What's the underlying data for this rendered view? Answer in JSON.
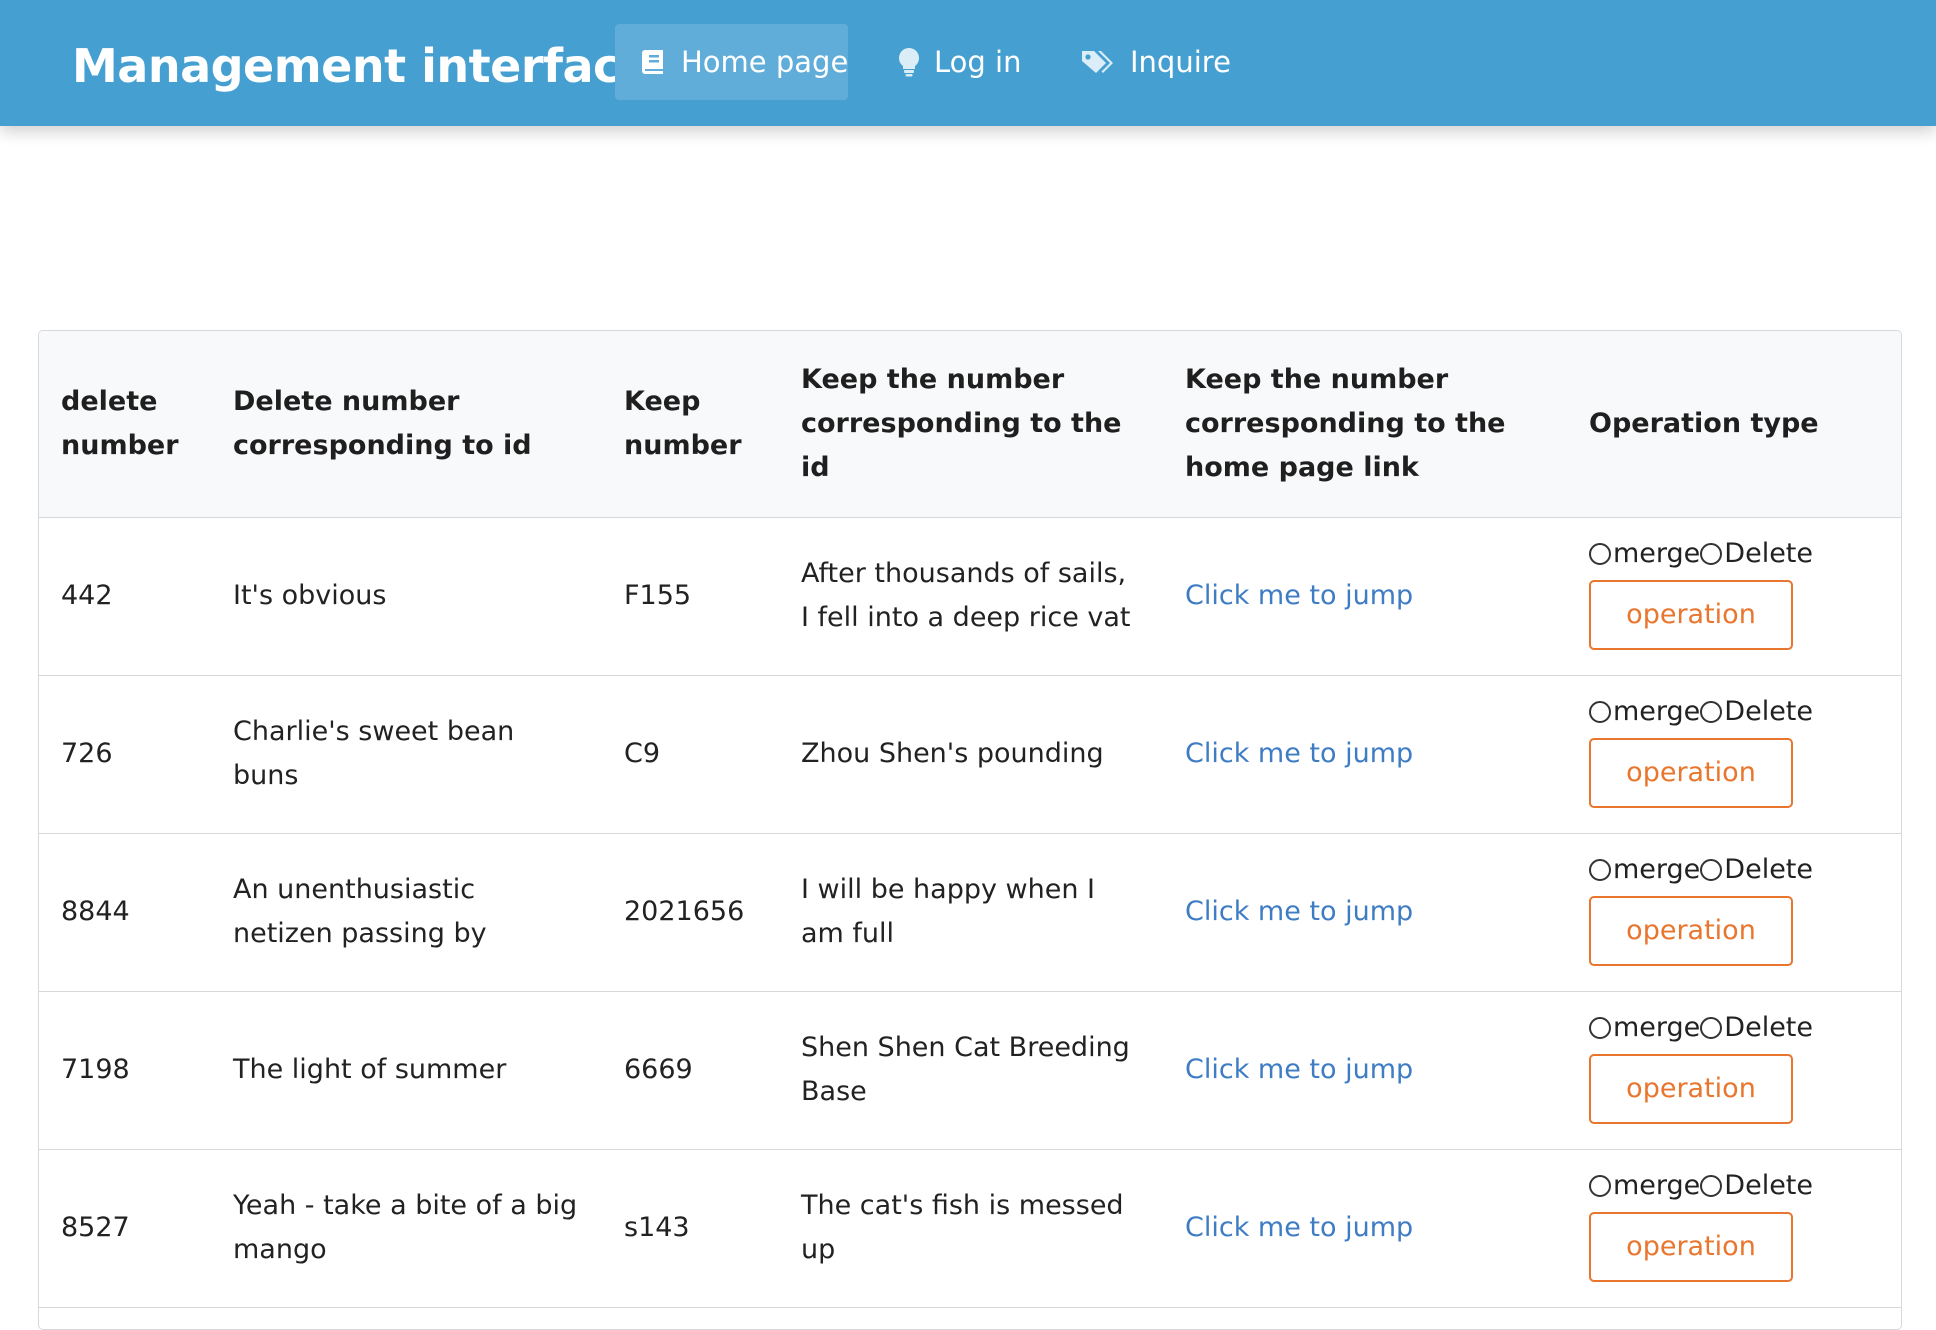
{
  "header": {
    "brand": "Management interface",
    "nav": [
      {
        "label": "Home page",
        "icon": "book-icon",
        "active": true
      },
      {
        "label": "Log in",
        "icon": "lightbulb-icon",
        "active": false
      },
      {
        "label": "Inquire",
        "icon": "tags-icon",
        "active": false
      }
    ]
  },
  "table": {
    "headers": [
      "delete number",
      "Delete number corresponding to id",
      "Keep number",
      "Keep the number corresponding to the id",
      "Keep the number corresponding to the home page link",
      "Operation type"
    ],
    "rows": [
      {
        "delete_number": "442",
        "delete_id": "It's obvious",
        "keep_number": "F155",
        "keep_id": "After thousands of sails, I fell into a deep rice vat",
        "link": "Click me to jump"
      },
      {
        "delete_number": "726",
        "delete_id": "Charlie's sweet bean buns",
        "keep_number": "C9",
        "keep_id": "Zhou Shen's pounding",
        "link": "Click me to jump"
      },
      {
        "delete_number": "8844",
        "delete_id": "An unenthusiastic netizen passing by",
        "keep_number": "2021656",
        "keep_id": "I will be happy when I am full",
        "link": "Click me to jump"
      },
      {
        "delete_number": "7198",
        "delete_id": "The light of summer",
        "keep_number": "6669",
        "keep_id": "Shen Shen Cat Breeding Base",
        "link": "Click me to jump"
      },
      {
        "delete_number": "8527",
        "delete_id": "Yeah - take a bite of a big mango",
        "keep_number": "s143",
        "keep_id": "The cat's fish is messed up",
        "link": "Click me to jump"
      }
    ],
    "radio_merge_label": "merge",
    "radio_delete_label": "Delete",
    "operation_label": "operation"
  },
  "colors": {
    "navbar": "#459fd0",
    "active_tab": "#5fadd8",
    "link": "#3e7cc4",
    "operation": "#e8762e"
  }
}
